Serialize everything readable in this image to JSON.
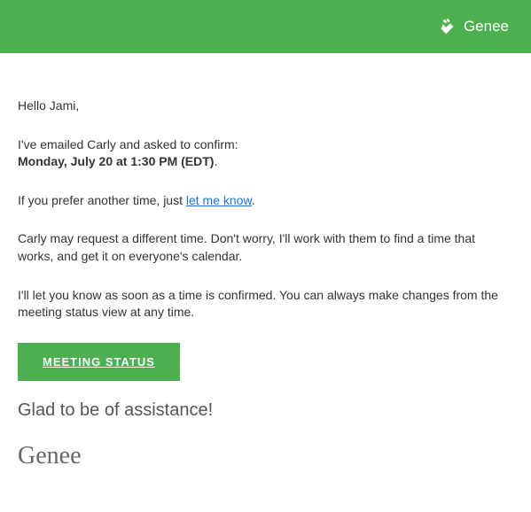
{
  "header": {
    "brand": "Genee"
  },
  "body": {
    "greeting": "Hello Jami,",
    "line1_pre": "I've emailed Carly and asked to confirm:",
    "line1_bold": "Monday, July 20 at 1:30 PM (EDT)",
    "line1_suffix": ".",
    "line2_pre": "If you prefer another time, just ",
    "line2_link": "let me know",
    "line2_post": ".",
    "line3": "Carly may request a different time. Don't worry, I'll work with them to find a time that works, and get it on everyone's calendar.",
    "line4": "I'll let you know as soon as a time is confirmed. You can always make changes from the meeting status view at any time.",
    "button": "MEETING STATUS",
    "closing": "Glad to be of assistance!",
    "signature": "Genee"
  }
}
